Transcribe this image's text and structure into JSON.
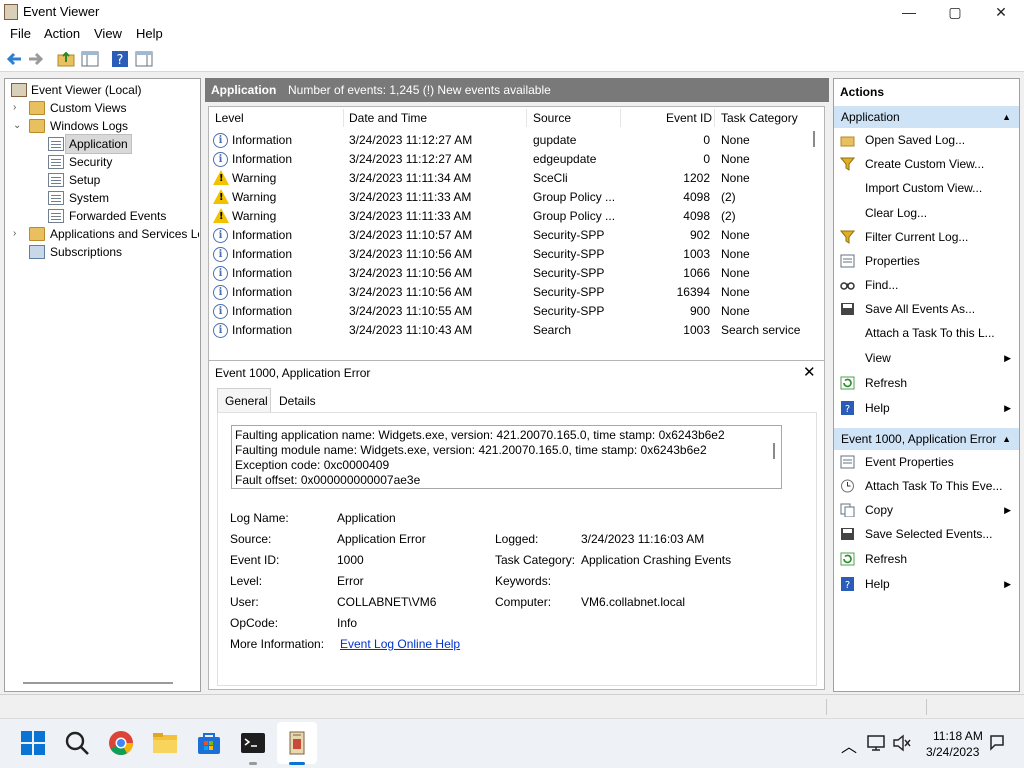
{
  "window": {
    "title": "Event Viewer",
    "minimize": "—",
    "maximize": "▢",
    "close": "✕"
  },
  "menu": {
    "file": "File",
    "action": "Action",
    "view": "View",
    "help": "Help"
  },
  "tree": {
    "root": "Event Viewer (Local)",
    "custom_views": "Custom Views",
    "windows_logs": "Windows Logs",
    "application": "Application",
    "security": "Security",
    "setup": "Setup",
    "system": "System",
    "forwarded": "Forwarded Events",
    "apps_services": "Applications and Services Lo",
    "subscriptions": "Subscriptions"
  },
  "pane": {
    "title": "Application",
    "info": "Number of events: 1,245 (!) New events available"
  },
  "columns": {
    "level": "Level",
    "date": "Date and Time",
    "source": "Source",
    "event_id": "Event ID",
    "task": "Task Category"
  },
  "events": [
    {
      "level": "Information",
      "type": "info",
      "date": "3/24/2023 11:12:27 AM",
      "source": "gupdate",
      "id": "0",
      "task": "None"
    },
    {
      "level": "Information",
      "type": "info",
      "date": "3/24/2023 11:12:27 AM",
      "source": "edgeupdate",
      "id": "0",
      "task": "None"
    },
    {
      "level": "Warning",
      "type": "warn",
      "date": "3/24/2023 11:11:34 AM",
      "source": "SceCli",
      "id": "1202",
      "task": "None"
    },
    {
      "level": "Warning",
      "type": "warn",
      "date": "3/24/2023 11:11:33 AM",
      "source": "Group Policy ...",
      "id": "4098",
      "task": "(2)"
    },
    {
      "level": "Warning",
      "type": "warn",
      "date": "3/24/2023 11:11:33 AM",
      "source": "Group Policy ...",
      "id": "4098",
      "task": "(2)"
    },
    {
      "level": "Information",
      "type": "info",
      "date": "3/24/2023 11:10:57 AM",
      "source": "Security-SPP",
      "id": "902",
      "task": "None"
    },
    {
      "level": "Information",
      "type": "info",
      "date": "3/24/2023 11:10:56 AM",
      "source": "Security-SPP",
      "id": "1003",
      "task": "None"
    },
    {
      "level": "Information",
      "type": "info",
      "date": "3/24/2023 11:10:56 AM",
      "source": "Security-SPP",
      "id": "1066",
      "task": "None"
    },
    {
      "level": "Information",
      "type": "info",
      "date": "3/24/2023 11:10:56 AM",
      "source": "Security-SPP",
      "id": "16394",
      "task": "None"
    },
    {
      "level": "Information",
      "type": "info",
      "date": "3/24/2023 11:10:55 AM",
      "source": "Security-SPP",
      "id": "900",
      "task": "None"
    },
    {
      "level": "Information",
      "type": "info",
      "date": "3/24/2023 11:10:43 AM",
      "source": "Search",
      "id": "1003",
      "task": "Search service"
    }
  ],
  "detail": {
    "title": "Event 1000, Application Error",
    "tab_general": "General",
    "tab_details": "Details",
    "message": [
      "Faulting application name: Widgets.exe, version: 421.20070.165.0, time stamp: 0x6243b6e2",
      "Faulting module name: Widgets.exe, version: 421.20070.165.0, time stamp: 0x6243b6e2",
      "Exception code: 0xc0000409",
      "Fault offset: 0x000000000007ae3e"
    ],
    "log_name_label": "Log Name:",
    "log_name": "Application",
    "source_label": "Source:",
    "source": "Application Error",
    "logged_label": "Logged:",
    "logged": "3/24/2023 11:16:03 AM",
    "event_id_label": "Event ID:",
    "event_id": "1000",
    "task_label": "Task Category:",
    "task": "Application Crashing Events",
    "level_label": "Level:",
    "level": "Error",
    "keywords_label": "Keywords:",
    "user_label": "User:",
    "user": "COLLABNET\\VM6",
    "computer_label": "Computer:",
    "computer": "VM6.collabnet.local",
    "opcode_label": "OpCode:",
    "opcode": "Info",
    "more_info_label": "More Information:",
    "more_info_link": "Event Log Online Help"
  },
  "actions": {
    "title": "Actions",
    "section1": "Application",
    "items1": [
      "Open Saved Log...",
      "Create Custom View...",
      "Import Custom View...",
      "Clear Log...",
      "Filter Current Log...",
      "Properties",
      "Find...",
      "Save All Events As...",
      "Attach a Task To this L...",
      "View",
      "Refresh",
      "Help"
    ],
    "section2": "Event 1000, Application Error",
    "items2": [
      "Event Properties",
      "Attach Task To This Eve...",
      "Copy",
      "Save Selected Events...",
      "Refresh",
      "Help"
    ]
  },
  "taskbar": {
    "time": "11:18 AM",
    "date": "3/24/2023"
  },
  "colors": {
    "accent": "#cfe3f6",
    "pane_header": "#797979",
    "link": "#0033cc"
  }
}
